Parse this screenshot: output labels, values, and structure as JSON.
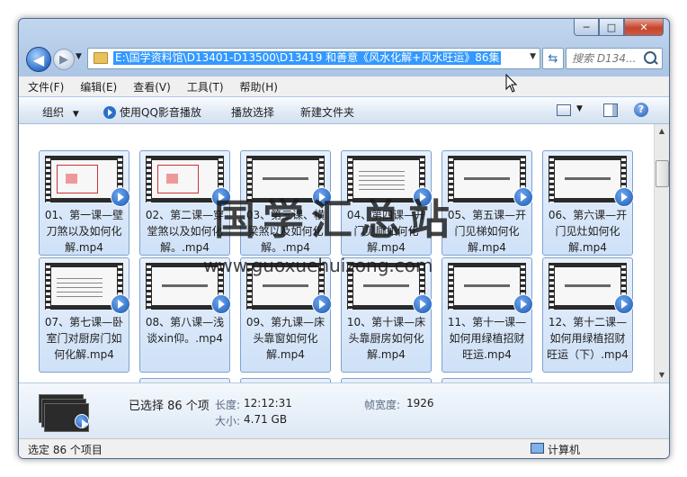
{
  "window": {
    "caption_buttons": {
      "minimize": "─",
      "maximize": "□",
      "close": "✕"
    }
  },
  "address": {
    "path": "E:\\国学资料馆\\D13401-D13500\\D13419 和善意《风水化解+风水旺运》86集",
    "search_placeholder": "搜索 D134..."
  },
  "menu": [
    "文件(F)",
    "编辑(E)",
    "查看(V)",
    "工具(T)",
    "帮助(H)"
  ],
  "toolbar": {
    "organize": "组织",
    "play_qq": "使用QQ影音播放",
    "play_selection": "播放选择",
    "new_folder": "新建文件夹"
  },
  "files": [
    {
      "label": "01、第一课—壁刀煞以及如何化解.mp4",
      "thumb": "plan"
    },
    {
      "label": "02、第二课—穿堂煞以及如何化解。.mp4",
      "thumb": "plan"
    },
    {
      "label": "03、第三课、横梁煞以及如何化解。.mp4",
      "thumb": "bar"
    },
    {
      "label": "04、第四课—开门见厕如何化解.mp4",
      "thumb": "lines"
    },
    {
      "label": "05、第五课—开门见梯如何化解.mp4",
      "thumb": "bar"
    },
    {
      "label": "06、第六课—开门见灶如何化解.mp4",
      "thumb": "bar"
    },
    {
      "label": "07、第七课—卧室门对厨房门如何化解.mp4",
      "thumb": "lines"
    },
    {
      "label": "08、第八课—浅谈xin仰。.mp4",
      "thumb": "bar"
    },
    {
      "label": "09、第九课—床头靠窗如何化解.mp4",
      "thumb": "bar"
    },
    {
      "label": "10、第十课—床头靠厨房如何化解.mp4",
      "thumb": "bar"
    },
    {
      "label": "11、第十一课—如何用绿植招财旺运.mp4",
      "thumb": "bar"
    },
    {
      "label": "12、第十二课—如何用绿植招财旺运（下）.mp4",
      "thumb": "bar"
    }
  ],
  "details": {
    "selected": "已选择 86 个项",
    "length_label": "长度:",
    "length_value": "12:12:31",
    "size_label": "大小:",
    "size_value": "4.71 GB",
    "frame_width_label": "帧宽度:",
    "frame_width_value": "1926"
  },
  "status": {
    "selected_count": "选定 86 个项目",
    "location": "计算机"
  },
  "watermark": {
    "title": "国学汇总站",
    "url": "www.guoxuehuizong.com"
  }
}
